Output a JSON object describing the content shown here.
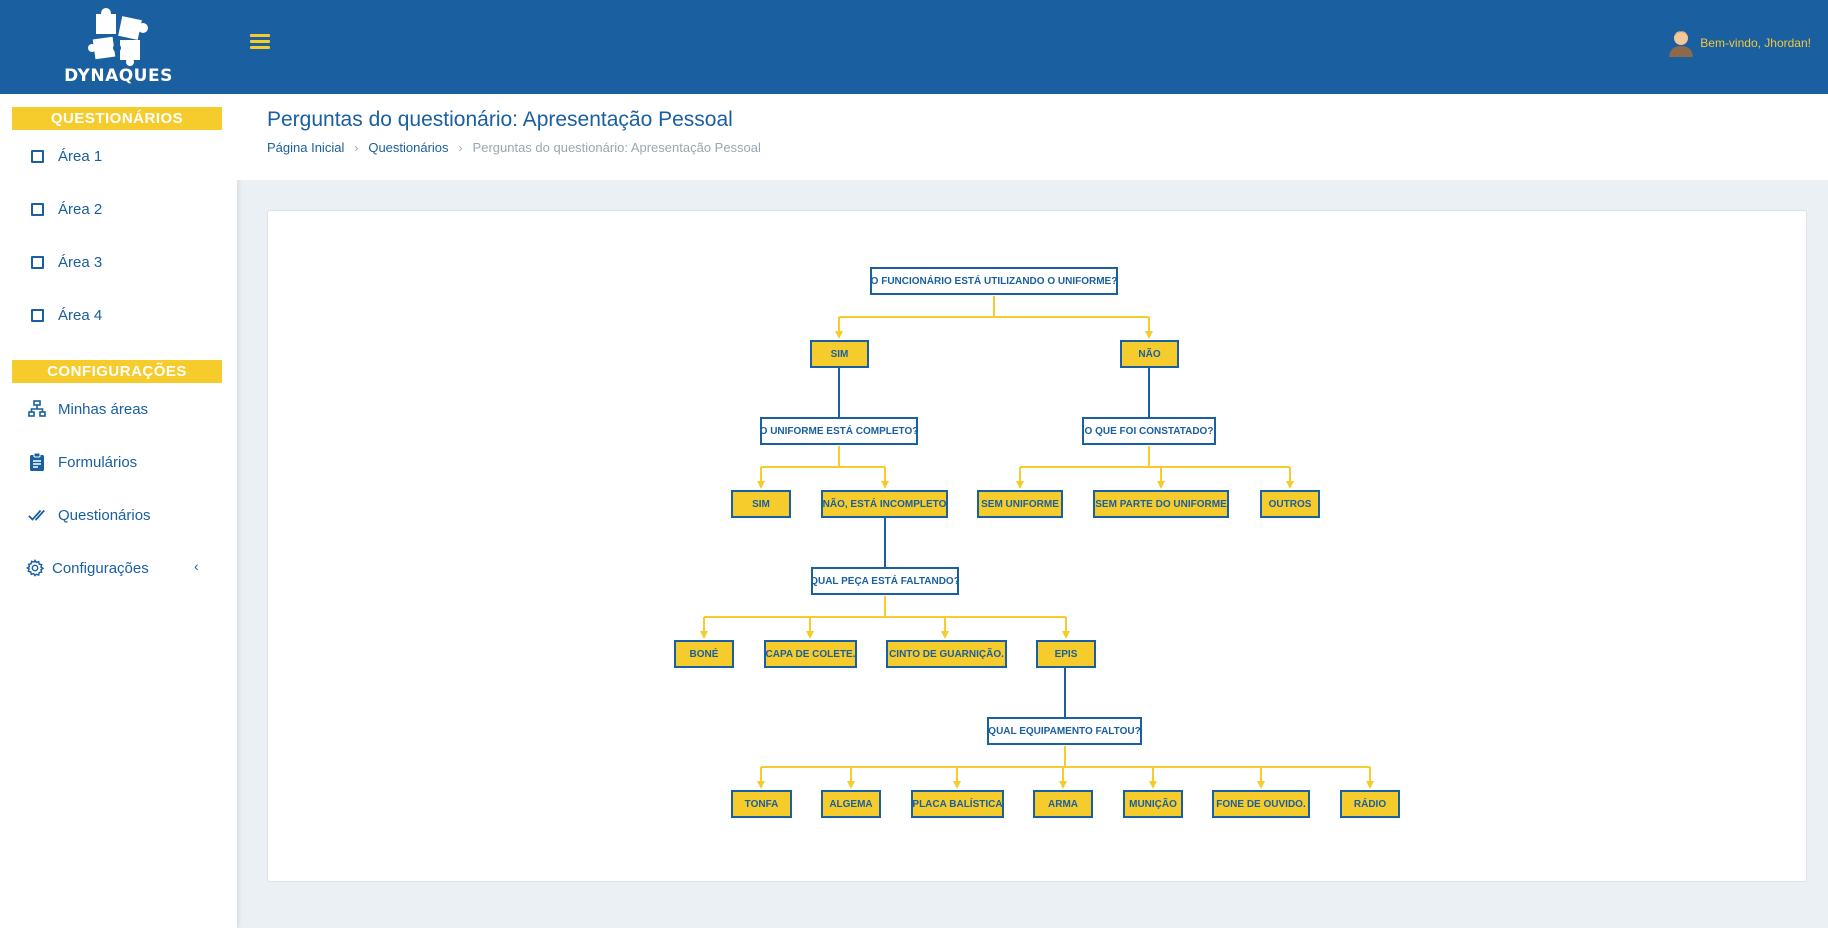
{
  "brand": {
    "logo_text": "DYNAQUES"
  },
  "topbar": {
    "welcome": "Bem-vindo, Jhordan!"
  },
  "sidebar": {
    "section1": "QUESTIONÁRIOS",
    "areas": [
      "Área 1",
      "Área 2",
      "Área 3",
      "Área 4"
    ],
    "section2": "CONFIGURAÇÕES",
    "config_items": [
      "Minhas áreas",
      "Formulários",
      "Questionários",
      "Configurações"
    ]
  },
  "header": {
    "title": "Perguntas do questionário: Apresentação Pessoal",
    "breadcrumb": [
      "Página Inicial",
      "Questionários",
      "Perguntas do questionário: Apresentação Pessoal"
    ]
  },
  "colors": {
    "primary": "#1a5fa0",
    "accent": "#f6cc2c"
  },
  "tree": {
    "q1": "O FUNCIONÁRIO ESTÁ UTILIZANDO O UNIFORME?",
    "q1_sim": "SIM",
    "q1_nao": "NÃO",
    "q2": "O UNIFORME ESTÁ COMPLETO?",
    "q3": "O QUE FOI CONSTATADO?",
    "q2_sim": "SIM",
    "q2_nao": "NÃO, ESTÁ INCOMPLETO",
    "q3_a1": "SEM UNIFORME",
    "q3_a2": "SEM PARTE DO UNIFORME",
    "q3_a3": "OUTROS",
    "q4": "QUAL PEÇA ESTÁ FALTANDO?",
    "q4_a1": "BONÉ",
    "q4_a2": "CAPA DE COLETE.",
    "q4_a3": "CINTO DE GUARNIÇÃO.",
    "q4_a4": "EPIS",
    "q5": "QUAL EQUIPAMENTO FALTOU?",
    "q5_a1": "TONFA",
    "q5_a2": "ALGEMA",
    "q5_a3": "PLACA BALÍSTICA",
    "q5_a4": "ARMA",
    "q5_a5": "MUNIÇÃO",
    "q5_a6": "FONE DE OUVIDO.",
    "q5_a7": "RÁDIO"
  }
}
